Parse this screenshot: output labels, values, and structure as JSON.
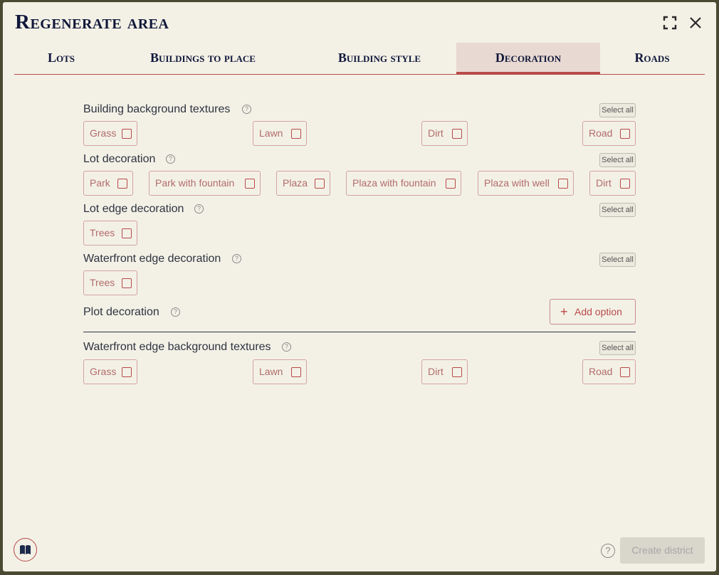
{
  "dialog": {
    "title": "Regenerate area"
  },
  "tabs": [
    {
      "label": "Lots"
    },
    {
      "label": "Buildings to place"
    },
    {
      "label": "Building style"
    },
    {
      "label": "Decoration",
      "active": true
    },
    {
      "label": "Roads"
    }
  ],
  "help_glyph": "?",
  "select_all_label": "Select all",
  "sections": {
    "building_bg": {
      "title": "Building background textures",
      "options": [
        "Grass",
        "Lawn",
        "Dirt",
        "Road"
      ]
    },
    "lot_decoration": {
      "title": "Lot decoration",
      "options": [
        "Park",
        "Park with fountain",
        "Plaza",
        "Plaza with fountain",
        "Plaza with well",
        "Dirt"
      ]
    },
    "lot_edge": {
      "title": "Lot edge decoration",
      "options": [
        "Trees"
      ]
    },
    "waterfront_edge": {
      "title": "Waterfront edge decoration",
      "options": [
        "Trees"
      ]
    },
    "plot_decoration": {
      "title": "Plot decoration",
      "add_option_label": "Add option",
      "add_glyph": "+"
    },
    "waterfront_bg": {
      "title": "Waterfront edge background textures",
      "options": [
        "Grass",
        "Lawn",
        "Dirt",
        "Road"
      ]
    }
  },
  "footer": {
    "create_label": "Create district"
  },
  "colors": {
    "accent": "#b84a4a",
    "title": "#10173a",
    "background": "#f3f1e6",
    "active_tab": "#e8d9d2"
  },
  "icons": [
    "expand-icon",
    "close-icon",
    "help-icon",
    "plus-icon",
    "book-icon"
  ]
}
